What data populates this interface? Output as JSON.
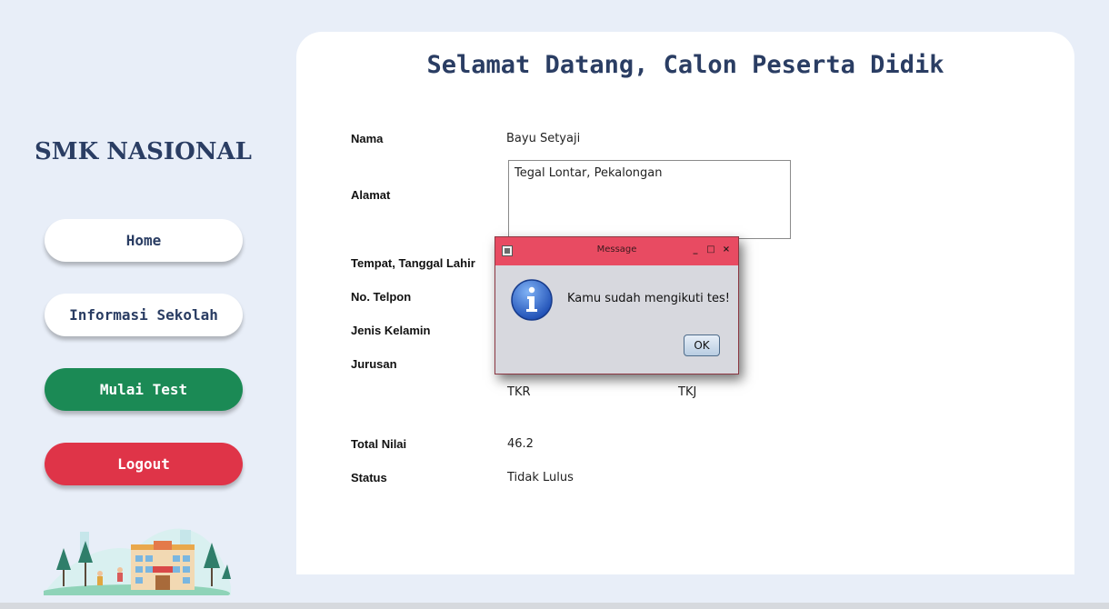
{
  "sidebar": {
    "brand": "SMK NASIONAL",
    "nav": {
      "home": "Home",
      "info": "Informasi Sekolah",
      "test": "Mulai Test",
      "logout": "Logout"
    }
  },
  "main": {
    "welcome": "Selamat Datang, Calon Peserta Didik",
    "fields": {
      "nama_label": "Nama",
      "nama_value": "Bayu Setyaji",
      "alamat_label": "Alamat",
      "alamat_value": "Tegal Lontar, Pekalongan",
      "ttl_label": "Tempat, Tanggal Lahir",
      "telpon_label": "No. Telpon",
      "jk_label": "Jenis Kelamin",
      "jurusan_label": "Jurusan",
      "jurusan_option1": "TKR",
      "jurusan_option2": "TKJ",
      "total_label": "Total Nilai",
      "total_value": "46.2",
      "status_label": "Status",
      "status_value": "Tidak Lulus"
    }
  },
  "dialog": {
    "title": "Message",
    "message": "Kamu sudah mengikuti tes!",
    "ok": "OK",
    "minimize_glyph": "_",
    "maximize_glyph": "□",
    "close_glyph": "×"
  },
  "colors": {
    "accent": "#2a3d63",
    "test_button": "#1b8a55",
    "logout_button": "#df3448",
    "dialog_title": "#e84b62",
    "background": "#e8eef8"
  }
}
